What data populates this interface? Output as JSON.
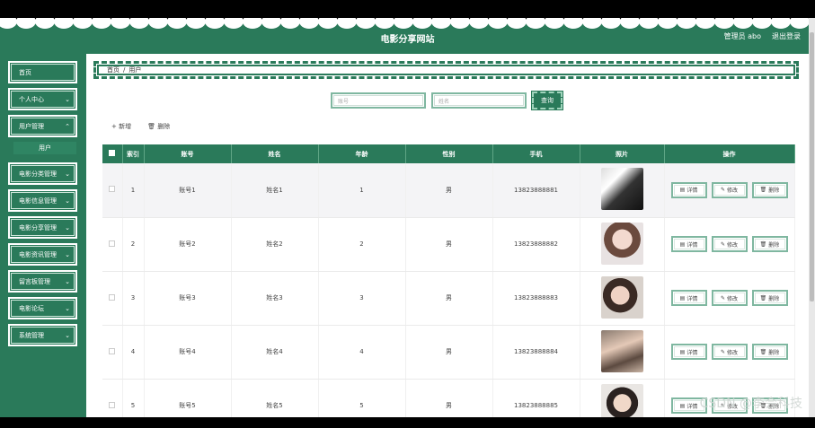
{
  "header": {
    "title": "电影分享网站",
    "user_label": "管理员 abo",
    "logout_label": "退出登录"
  },
  "sidebar": {
    "items": [
      {
        "label": "首页"
      },
      {
        "label": "个人中心"
      },
      {
        "label": "用户管理"
      },
      {
        "label": "电影分类管理"
      },
      {
        "label": "电影信息管理"
      },
      {
        "label": "电影分享管理"
      },
      {
        "label": "电影资讯管理"
      },
      {
        "label": "留言板管理"
      },
      {
        "label": "电影论坛"
      },
      {
        "label": "系统管理"
      }
    ],
    "submenu_user": "用户"
  },
  "breadcrumb": {
    "home": "首页",
    "sep": "/",
    "current": "用户"
  },
  "search": {
    "account_placeholder": "账号",
    "name_placeholder": "姓名",
    "query_label": "查询"
  },
  "toolbar": {
    "add_label": "+ 新增",
    "delete_label": "删除"
  },
  "table": {
    "headers": [
      "索引",
      "账号",
      "姓名",
      "年龄",
      "性别",
      "手机",
      "照片",
      "操作"
    ],
    "rows": [
      {
        "index": "1",
        "account": "账号1",
        "name": "姓名1",
        "age": "1",
        "gender": "男",
        "phone": "13823888881"
      },
      {
        "index": "2",
        "account": "账号2",
        "name": "姓名2",
        "age": "2",
        "gender": "男",
        "phone": "13823888882"
      },
      {
        "index": "3",
        "account": "账号3",
        "name": "姓名3",
        "age": "3",
        "gender": "男",
        "phone": "13823888883"
      },
      {
        "index": "4",
        "account": "账号4",
        "name": "姓名4",
        "age": "4",
        "gender": "男",
        "phone": "13823888884"
      },
      {
        "index": "5",
        "account": "账号5",
        "name": "姓名5",
        "age": "5",
        "gender": "男",
        "phone": "13823888885"
      }
    ],
    "op_detail": "详情",
    "op_edit": "修改",
    "op_delete": "删除"
  },
  "watermark": "CSDN @李会科技",
  "colors": {
    "primary": "#2a7a5a",
    "accent_light": "#7fb7a0"
  }
}
